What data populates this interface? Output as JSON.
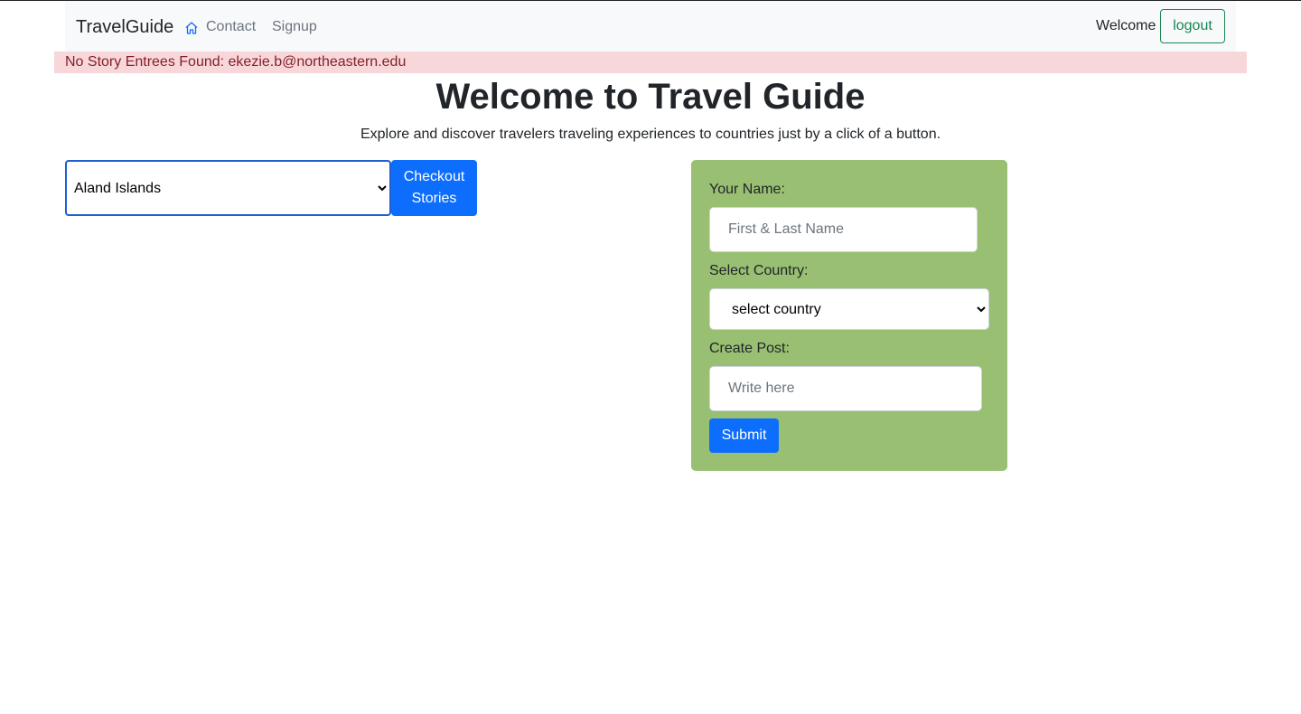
{
  "navbar": {
    "brand": "TravelGuide",
    "links": [
      {
        "label": "Contact",
        "icon": "home-icon"
      },
      {
        "label": "Signup"
      }
    ],
    "welcome_text": "Welcome",
    "logout_label": "logout"
  },
  "alert": {
    "text": "No Story Entrees Found: ekezie.b@northeastern.edu"
  },
  "hero": {
    "title": "Welcome to Travel Guide",
    "subtitle": "Explore and discover travelers traveling experiences to countries just by a click of a button."
  },
  "browse": {
    "selected_country": "Aland Islands",
    "checkout_label": "Checkout Stories"
  },
  "form": {
    "name_label": "Your Name:",
    "name_placeholder": "First & Last Name",
    "country_label": "Select Country:",
    "country_selected": "select country",
    "post_label": "Create Post:",
    "post_placeholder": "Write here",
    "submit_label": "Submit"
  },
  "colors": {
    "primary": "#0d6efd",
    "success": "#198754",
    "alert_bg": "#f8d7da",
    "alert_text": "#842029",
    "card_bg": "#98bf72",
    "navbar_bg": "#f8f9fa"
  }
}
